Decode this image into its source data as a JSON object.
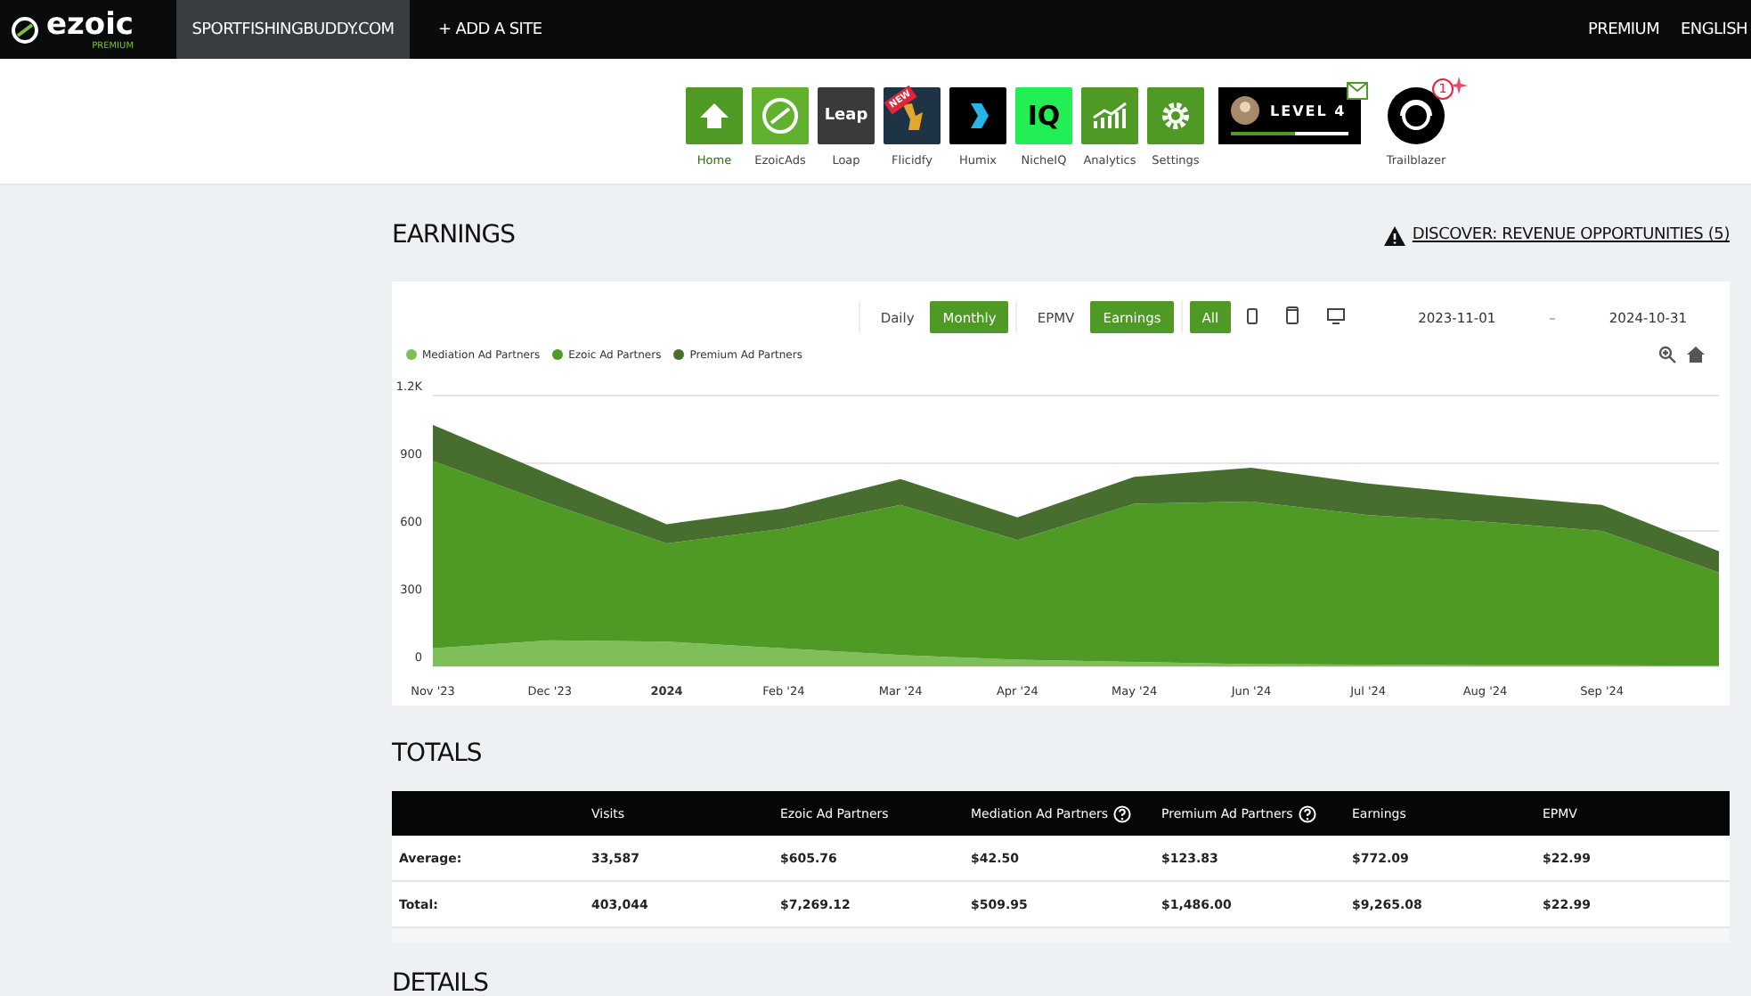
{
  "topbar": {
    "logo": "ezoic",
    "logo_sub": "PREMIUM",
    "sites": [
      {
        "label": "SPORTFISHINGBUDDY.COM",
        "selected": true
      },
      {
        "label": "+ ADD A SITE",
        "selected": false
      }
    ],
    "right": [
      "PREMIUM",
      "ENGLISH"
    ]
  },
  "apps": [
    {
      "kind": "home",
      "label": "Home",
      "selected": true
    },
    {
      "kind": "ezoicads",
      "label": "EzoicAds",
      "selected": false
    },
    {
      "kind": "leap",
      "label": "Loap",
      "logo": "Leap",
      "selected": false
    },
    {
      "kind": "flickify",
      "label": "Flicidfy",
      "badge": "NEW",
      "selected": false
    },
    {
      "kind": "humix",
      "label": "Humix",
      "selected": false
    },
    {
      "kind": "nicheiq",
      "label": "NicheIQ",
      "logo": "IQ",
      "selected": false
    },
    {
      "kind": "analytics",
      "label": "Analytics",
      "selected": false
    },
    {
      "kind": "settings",
      "label": "Settings",
      "selected": false
    }
  ],
  "level_badge": {
    "text": "LEVEL 4",
    "level": 0.55
  },
  "trailblazer": {
    "label": "Trailblazer",
    "count": "1"
  },
  "earnings": {
    "title": "EARNINGS",
    "discover": "DISCOVER: REVENUE OPPORTUNITIES (5)",
    "period_toggle": [
      {
        "label": "Daily",
        "selected": false
      },
      {
        "label": "Monthly",
        "selected": true
      }
    ],
    "metric_toggle": [
      {
        "label": "EPMV",
        "selected": false
      },
      {
        "label": "Earnings",
        "selected": true
      }
    ],
    "device_toggle": [
      {
        "kind": "all",
        "label": "All",
        "selected": true
      },
      {
        "kind": "tablet",
        "selected": false
      },
      {
        "kind": "phone",
        "selected": false
      },
      {
        "kind": "desktop",
        "selected": false
      }
    ],
    "date_from": "2023-11-01",
    "date_sep": "–",
    "date_to": "2024-10-31",
    "chart_data": {
      "type": "area",
      "stacked": true,
      "categories": [
        "Nov '23",
        "Dec '23",
        "2024",
        "Feb '24",
        "Mar '24",
        "Apr '24",
        "May '24",
        "Jun '24",
        "Jul '24",
        "Aug '24",
        "Sep '24",
        null
      ],
      "yticks": [
        {
          "value": 0,
          "label": "0"
        },
        {
          "value": 300,
          "label": "300"
        },
        {
          "value": 600,
          "label": "600"
        },
        {
          "value": 900,
          "label": "900"
        },
        {
          "value": 1200,
          "label": "1.2K"
        }
      ],
      "ylim": [
        0,
        1200
      ],
      "series": [
        {
          "name": "Mediation Ad Partners",
          "color": "#7fbf5a",
          "values": [
            80,
            115,
            110,
            80,
            50,
            30,
            20,
            10,
            8,
            5,
            5,
            3
          ]
        },
        {
          "name": "Ezoic Ad Partners",
          "color": "#4e9a25",
          "values": [
            830,
            605,
            435,
            530,
            665,
            530,
            700,
            720,
            662,
            635,
            595,
            412
          ]
        },
        {
          "name": "Premium Ad Partners",
          "color": "#476e2f",
          "values": [
            160,
            130,
            85,
            90,
            115,
            100,
            120,
            150,
            140,
            120,
            115,
            95
          ]
        }
      ]
    }
  },
  "totals": {
    "title": "TOTALS",
    "columns": [
      {
        "label": "Visits",
        "help": false
      },
      {
        "label": "Ezoic Ad Partners",
        "help": false
      },
      {
        "label": "Mediation Ad Partners",
        "help": true
      },
      {
        "label": "Premium Ad Partners",
        "help": true
      },
      {
        "label": "Earnings",
        "help": false
      },
      {
        "label": "EPMV",
        "help": false
      }
    ],
    "rows": [
      {
        "label": "Average:",
        "cells": [
          "33,587",
          "$605.76",
          "$42.50",
          "$123.83",
          "$772.09",
          "$22.99"
        ]
      },
      {
        "label": "Total:",
        "cells": [
          "403,044",
          "$7,269.12",
          "$509.95",
          "$1,486.00",
          "$9,265.08",
          "$22.99"
        ]
      }
    ]
  },
  "next_section": "DETAILS"
}
